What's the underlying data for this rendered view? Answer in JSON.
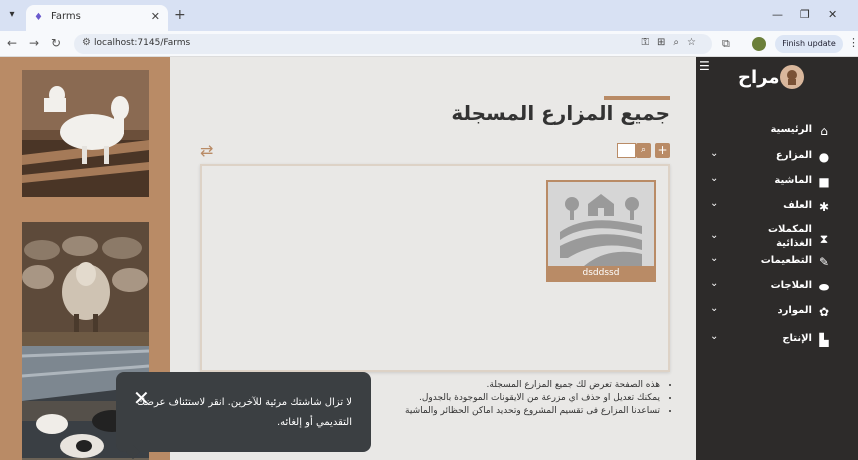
{
  "browser": {
    "tab_title": "Farms",
    "url": "localhost:7145/Farms",
    "update_label": "Finish update",
    "icons": [
      "tab-list-icon",
      "tab-favicon",
      "close-icon",
      "new-tab-icon",
      "minimize-icon",
      "maximize-icon",
      "window-close-icon",
      "back-icon",
      "forward-icon",
      "reload-icon",
      "site-info-icon",
      "password-key-icon",
      "translate-icon",
      "zoom-icon",
      "bookmark-star-icon",
      "extensions-icon",
      "profile-avatar-icon",
      "menu-icon"
    ]
  },
  "sidebar": {
    "brand": "مراح",
    "items": [
      {
        "label": "الرئيسية",
        "icon": "home-icon",
        "has_chevron": false
      },
      {
        "label": "المزارع",
        "icon": "location-pin-icon",
        "has_chevron": true
      },
      {
        "label": "الماشية",
        "icon": "truck-icon",
        "has_chevron": true
      },
      {
        "label": "العلف",
        "icon": "wheat-icon",
        "has_chevron": true
      },
      {
        "label": "المكملات الغذائية",
        "icon": "hourglass-icon",
        "has_chevron": true
      },
      {
        "label": "التطعيمات",
        "icon": "syringe-icon",
        "has_chevron": true
      },
      {
        "label": "العلاجات",
        "icon": "pills-icon",
        "has_chevron": true
      },
      {
        "label": "الموارد",
        "icon": "resources-icon",
        "has_chevron": true
      },
      {
        "label": "الإنتاج",
        "icon": "factory-icon",
        "has_chevron": true
      }
    ]
  },
  "main": {
    "title": "جميع المزارع المسجلة",
    "farm_card": {
      "name": "dsddssd"
    },
    "notes": [
      "هذه الصفحة تعرض لك جميع المزارع المسجلة.",
      "يمكنك تعديل او حذف اي مزرعة من الايقونات الموجودة بالجدول.",
      "تساعدنا المزارع فى تقسيم المشروع وتحديد اماكن الحظائر والماشية"
    ]
  },
  "toast": {
    "message": "لا تزال شاشتك مرئية للآخرين. انقر لاستئناف عرضك التقديمي أو إلغائه."
  },
  "colors": {
    "accent": "#b98b66",
    "sidebar_bg": "#2d2b2a",
    "page_bg": "#e9e8e6",
    "toast_bg": "#3b3f42"
  }
}
